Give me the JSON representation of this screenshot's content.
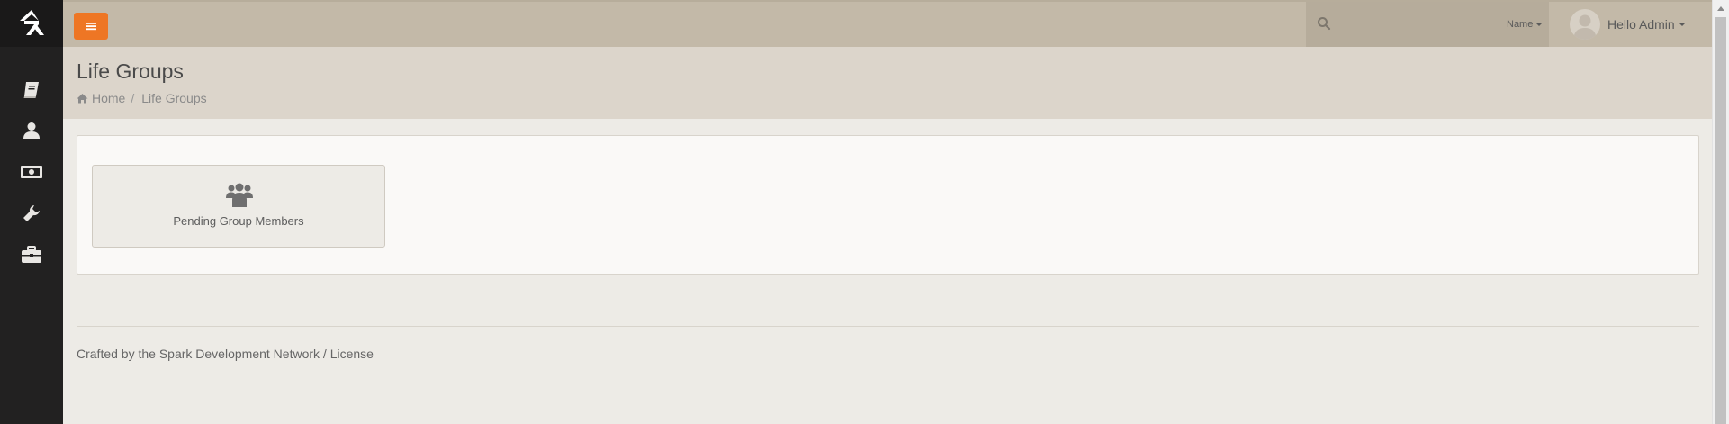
{
  "header": {
    "menu_icon": "hamburger-icon",
    "search": {
      "placeholder": "",
      "type_label": "Name"
    },
    "user": {
      "greeting": "Hello Admin"
    }
  },
  "sidebar": {
    "logo": "rock-logo",
    "items": [
      {
        "icon": "book-icon"
      },
      {
        "icon": "person-icon"
      },
      {
        "icon": "money-icon"
      },
      {
        "icon": "wrench-icon"
      },
      {
        "icon": "briefcase-icon"
      }
    ]
  },
  "page": {
    "title": "Life Groups",
    "breadcrumb": [
      "Home",
      "Life Groups"
    ],
    "breadcrumb_sep": "/"
  },
  "tiles": [
    {
      "icon": "users-icon",
      "label": "Pending Group Members"
    }
  ],
  "footer": {
    "text": "Crafted by the Spark Development Network / ",
    "link": "License"
  },
  "colors": {
    "accent": "#ee7624",
    "topbar": "#c3b9a8",
    "sidebar": "#222121",
    "page_header": "#dcd5cb",
    "background": "#edebe6"
  }
}
